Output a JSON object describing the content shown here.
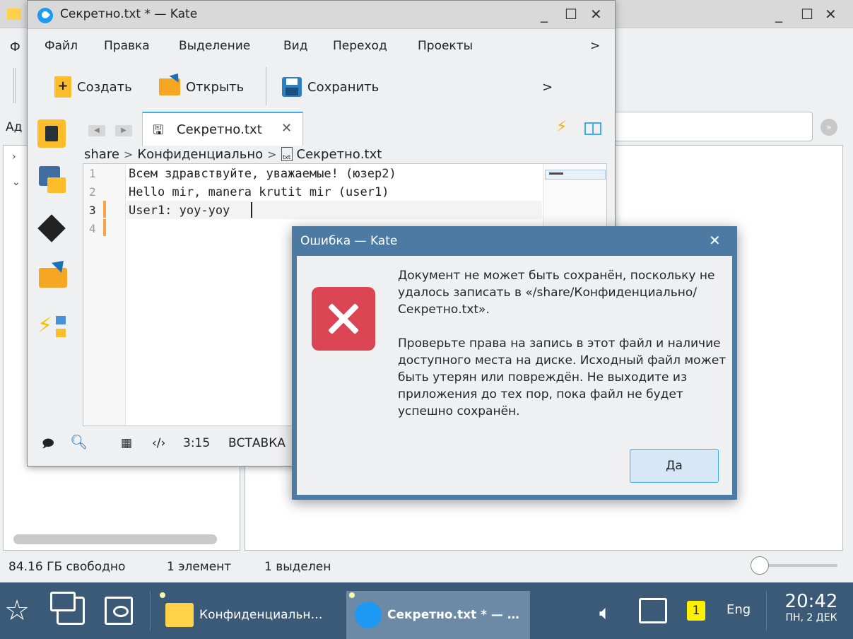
{
  "file_manager": {
    "window_controls": {
      "minimize": "_",
      "maximize": "☐",
      "close": "✕"
    },
    "menu_partial": "Ф",
    "address_label_partial": "Ад",
    "status": {
      "free_space": "84.16 ГБ свободно",
      "items": "1 элемент",
      "selected": "1 выделен"
    },
    "icons": {
      "folder": "folder-icon",
      "go": "go-icon"
    }
  },
  "kate": {
    "title": "Секретно.txt * — Kate",
    "window_controls": {
      "minimize": "_",
      "maximize": "☐",
      "close": "✕"
    },
    "menu": [
      "Файл",
      "Правка",
      "Выделение",
      "Вид",
      "Переход",
      "Проекты"
    ],
    "menu_more": ">",
    "toolbar": {
      "new_label": "Создать",
      "open_label": "Открыть",
      "save_label": "Сохранить",
      "more": ">"
    },
    "tab": {
      "name": "Секретно.txt",
      "close": "✕"
    },
    "breadcrumb": [
      "share",
      "Конфиденциально",
      "Секретно.txt"
    ],
    "breadcrumb_sep": ">",
    "file_icon_text": "txt",
    "lines": [
      {
        "num": "1",
        "text": "Всем здравствуйте, уважаемые! (юзер2)"
      },
      {
        "num": "2",
        "text": "Hello mir, manera krutit mir (user1)"
      },
      {
        "num": "3",
        "text": "User1: yoy-yoy"
      },
      {
        "num": "4",
        "text": ""
      }
    ],
    "status": {
      "position": "3:15",
      "mode": "ВСТАВКА"
    },
    "icons": [
      "documents-icon",
      "projects-icon",
      "git-icon",
      "file-browser-icon",
      "external-tools-icon"
    ]
  },
  "dialog": {
    "title": "Ошибка — Kate",
    "close": "✕",
    "message1": "Документ не может быть сохранён, поскольку не удалось записать в «/share/Конфиденциально/Секретно.txt».",
    "message2": "Проверьте права на запись в этот файл и наличие доступного места на диске. Исходный файл может быть утерян или повреждён. Не выходите из приложения до тех пор, пока файл не будет успешно сохранён.",
    "ok_label": "Да",
    "icon": "error-icon"
  },
  "taskbar": {
    "tasks": [
      {
        "label": "Конфиденциальн…",
        "active": false
      },
      {
        "label": "Секретно.txt * — …",
        "active": true
      }
    ],
    "notification_count": "1",
    "language": "Eng",
    "time": "20:42",
    "date": "ПН, 2 ДЕК"
  }
}
